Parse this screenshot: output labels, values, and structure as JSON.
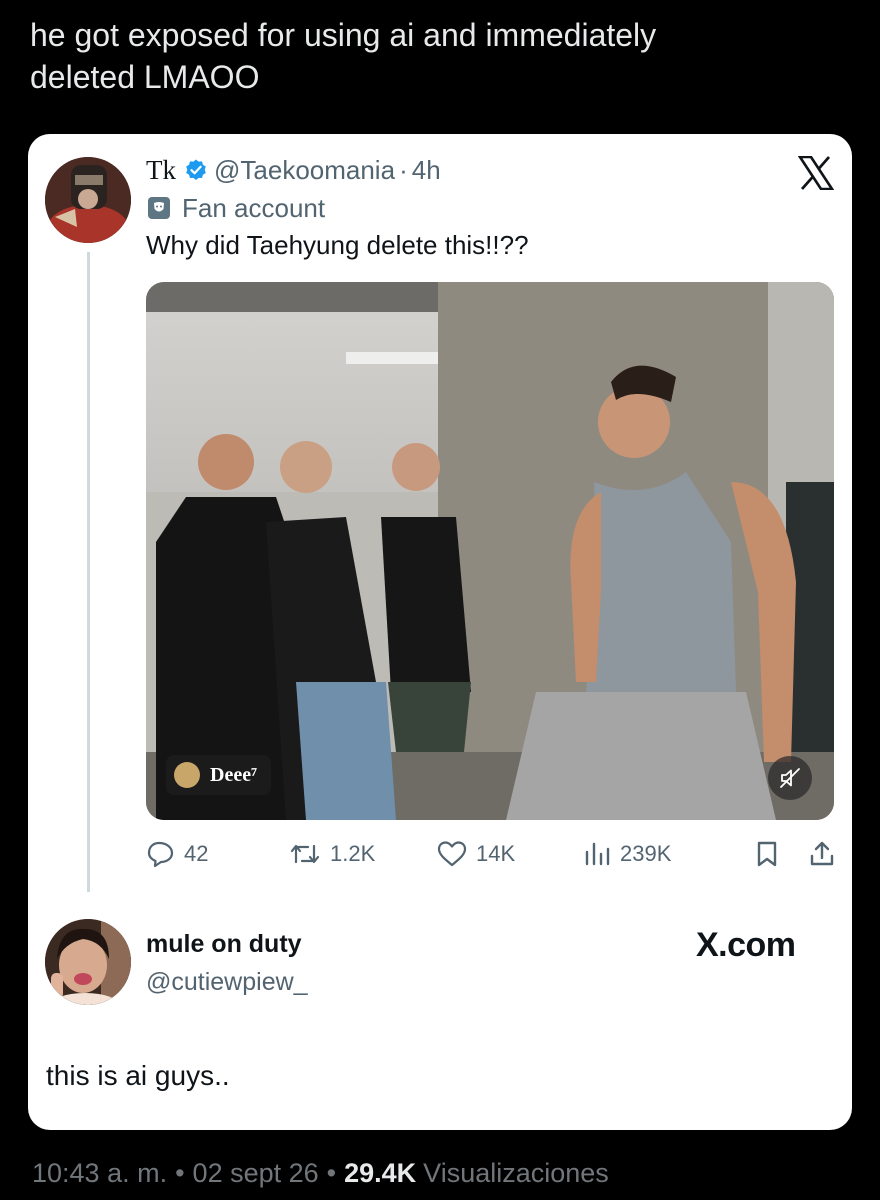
{
  "post": {
    "text": "he got exposed for using ai and immediately\ndeleted LMAOO"
  },
  "tweet": {
    "display_name": "Tk",
    "handle": "@Taekoomania",
    "separator": "·",
    "time": "4h",
    "label": "Fan account",
    "text": "Why did Taehyung delete this!!??",
    "media_watermark": "Deee⁷",
    "stats": {
      "replies": "42",
      "reposts": "1.2K",
      "likes": "14K",
      "views": "239K"
    }
  },
  "reply": {
    "display_name": "mule on duty",
    "handle": "@cutiewpiew_",
    "text": "this is ai guys..",
    "site": "X.com"
  },
  "footer": {
    "time": "10:43 a. m.",
    "dot": "•",
    "date": "02 sept 26",
    "views_count": "29.4K",
    "views_label": "Visualizaciones"
  },
  "colors": {
    "background": "#000000",
    "card": "#ffffff",
    "verified": "#1d9bf0",
    "secondary_text": "#536471"
  },
  "icons": [
    "verified-badge-icon",
    "fan-account-icon",
    "x-logo-icon",
    "reply-icon",
    "repost-icon",
    "like-icon",
    "views-icon",
    "bookmark-icon",
    "share-icon",
    "mute-icon"
  ]
}
